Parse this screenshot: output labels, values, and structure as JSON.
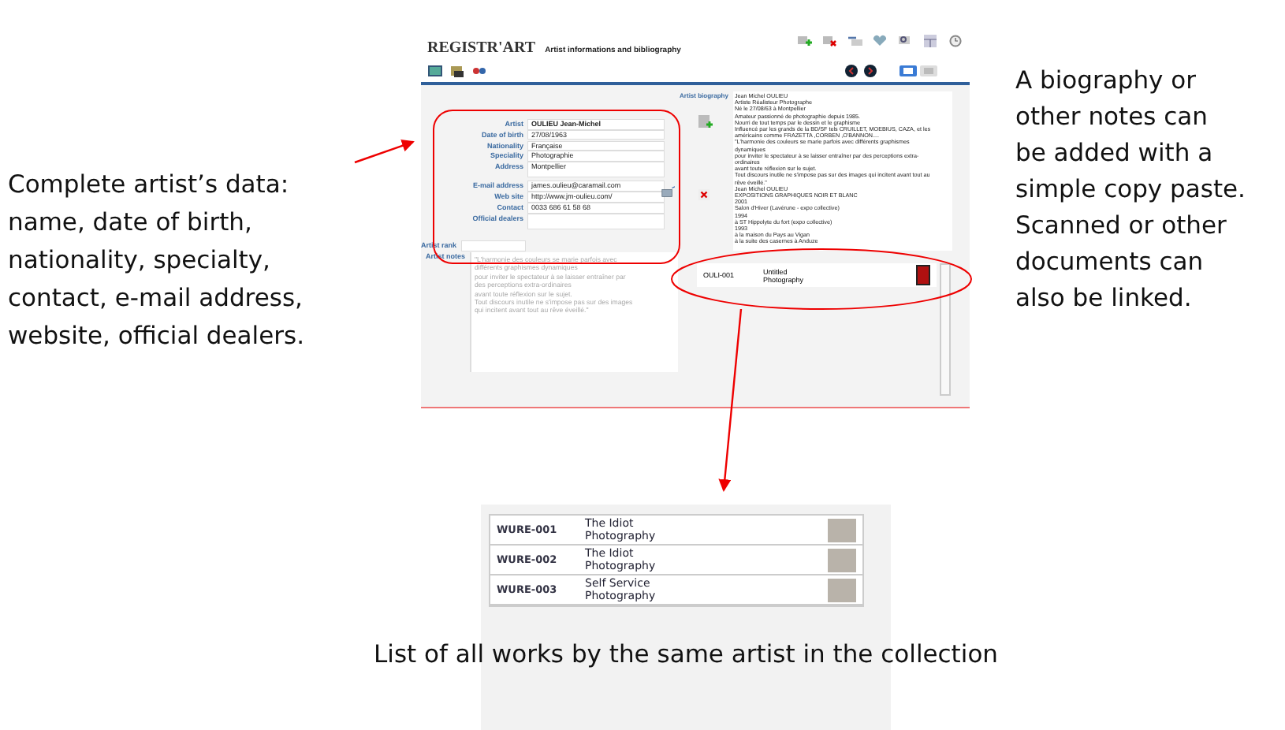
{
  "app": {
    "logo": "REGISTR'ART",
    "title": "Artist informations and bibliography"
  },
  "view_buttons": [
    {
      "selected": true
    },
    {
      "selected": false
    }
  ],
  "form": {
    "fields": [
      {
        "label": "Artist",
        "value": "OULIEU Jean-Michel",
        "kind": "name"
      },
      {
        "label": "Date of birth",
        "value": "27/08/1963",
        "kind": "line"
      },
      {
        "label": "Nationality",
        "value": "Française",
        "kind": "line"
      },
      {
        "label": "Speciality",
        "value": "Photographie",
        "kind": "line"
      },
      {
        "label": "Address",
        "value": "Montpellier",
        "kind": "box"
      },
      {
        "label": "E-mail address",
        "value": "james.oulieu@caramail.com",
        "kind": "line"
      },
      {
        "label": "Web site",
        "value": "http://www.jm-oulieu.com/",
        "kind": "line"
      },
      {
        "label": "Contact",
        "value": "0033 686 61 58 68",
        "kind": "line"
      },
      {
        "label": "Official dealers",
        "kind": "box"
      }
    ],
    "rank_label": "Artist rank",
    "notes_label": "Artist notes",
    "notes_lines": [
      "\"L'harmonie des couleurs se marie parfois avec",
      "différents graphismes dynamiques",
      "pour inviter le spectateur à se laisser entraîner par",
      "des perceptions extra-ordinaires",
      "avant toute réflexion sur le sujet.",
      "Tout discours inutile ne s'impose pas sur des images",
      "qui incitent avant tout au rêve éveillé.\""
    ]
  },
  "biography": {
    "label": "Artist biography",
    "lines": [
      "Jean Michel OULIEU",
      "Artiste Réalisteur Photographe",
      "Né le 27/08/63 à Montpellier",
      "Amateur passionné de photographie depuis 1985.",
      "Nourri de tout temps par le dessin et le graphisme",
      "Influencé par les grands de la BD/SF tels CRUILLET, MOEBIUS, CAZA, et les",
      "américains comme FRAZETTA ,CORBEN ,O'BANNON....",
      "\"L'harmonie des couleurs se marie parfois avec différents graphismes",
      "dynamiques",
      "pour inviter le spectateur à se laisser entraîner par des perceptions extra-",
      "ordinaires",
      "avant toute réflexion sur le sujet.",
      "Tout discours inutile ne s'impose pas sur des images qui incitent avant tout au",
      "rêve éveillé.\"",
      "Jean Michel OULIEU",
      "EXPOSITIONS GRAPHIQUES NOIR ET BLANC",
      "2001",
      "Salon d'Hiver (Lavérune - expo collective)",
      "1994",
      "à ST Hippolyte du fort (expo collective)",
      "1993",
      "à la maison du Pays au Vigan",
      "à la suite des casernes à Anduze"
    ]
  },
  "works": [
    {
      "code": "OULI-001",
      "title": "Untitled",
      "medium": "Photography"
    }
  ],
  "annotations": {
    "left": [
      "Complete artist’s data:",
      "name, date of birth,",
      "nationality, specialty,",
      "contact, e-mail address,",
      "website, official dealers."
    ],
    "right": [
      "A biography or",
      "other notes can",
      "be added with a",
      "simple copy paste.",
      "Scanned or other",
      "documents can",
      "also be linked."
    ],
    "caption": "List of all works by the same artist in the collection"
  },
  "works_list": [
    {
      "code": "WURE-001",
      "title": "The Idiot",
      "medium": "Photography"
    },
    {
      "code": "WURE-002",
      "title": "The Idiot",
      "medium": "Photography"
    },
    {
      "code": "WURE-003",
      "title": "Self Service",
      "medium": "Photography"
    }
  ]
}
